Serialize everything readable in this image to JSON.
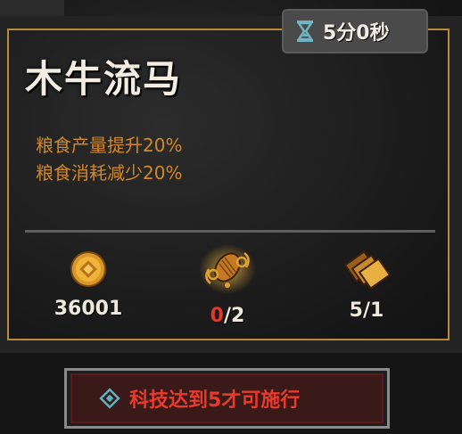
{
  "card": {
    "title": "木牛流马",
    "effects": [
      "粮食产量提升20%",
      "粮食消耗减少20%"
    ]
  },
  "timer": {
    "icon": "hourglass-icon",
    "text": "5分0秒"
  },
  "resources": [
    {
      "icon": "coin-icon",
      "value": "36001"
    },
    {
      "icon": "scroll-item-icon",
      "current": "0",
      "separator": "/",
      "required": "2"
    },
    {
      "icon": "card-stack-icon",
      "value": "5/1"
    }
  ],
  "action": {
    "icon": "diamond-icon",
    "label": "科技达到5才可施行"
  },
  "colors": {
    "gold_border": "#b88a3b",
    "effect_text": "#d2882a",
    "warning_red": "#e03a2c"
  }
}
